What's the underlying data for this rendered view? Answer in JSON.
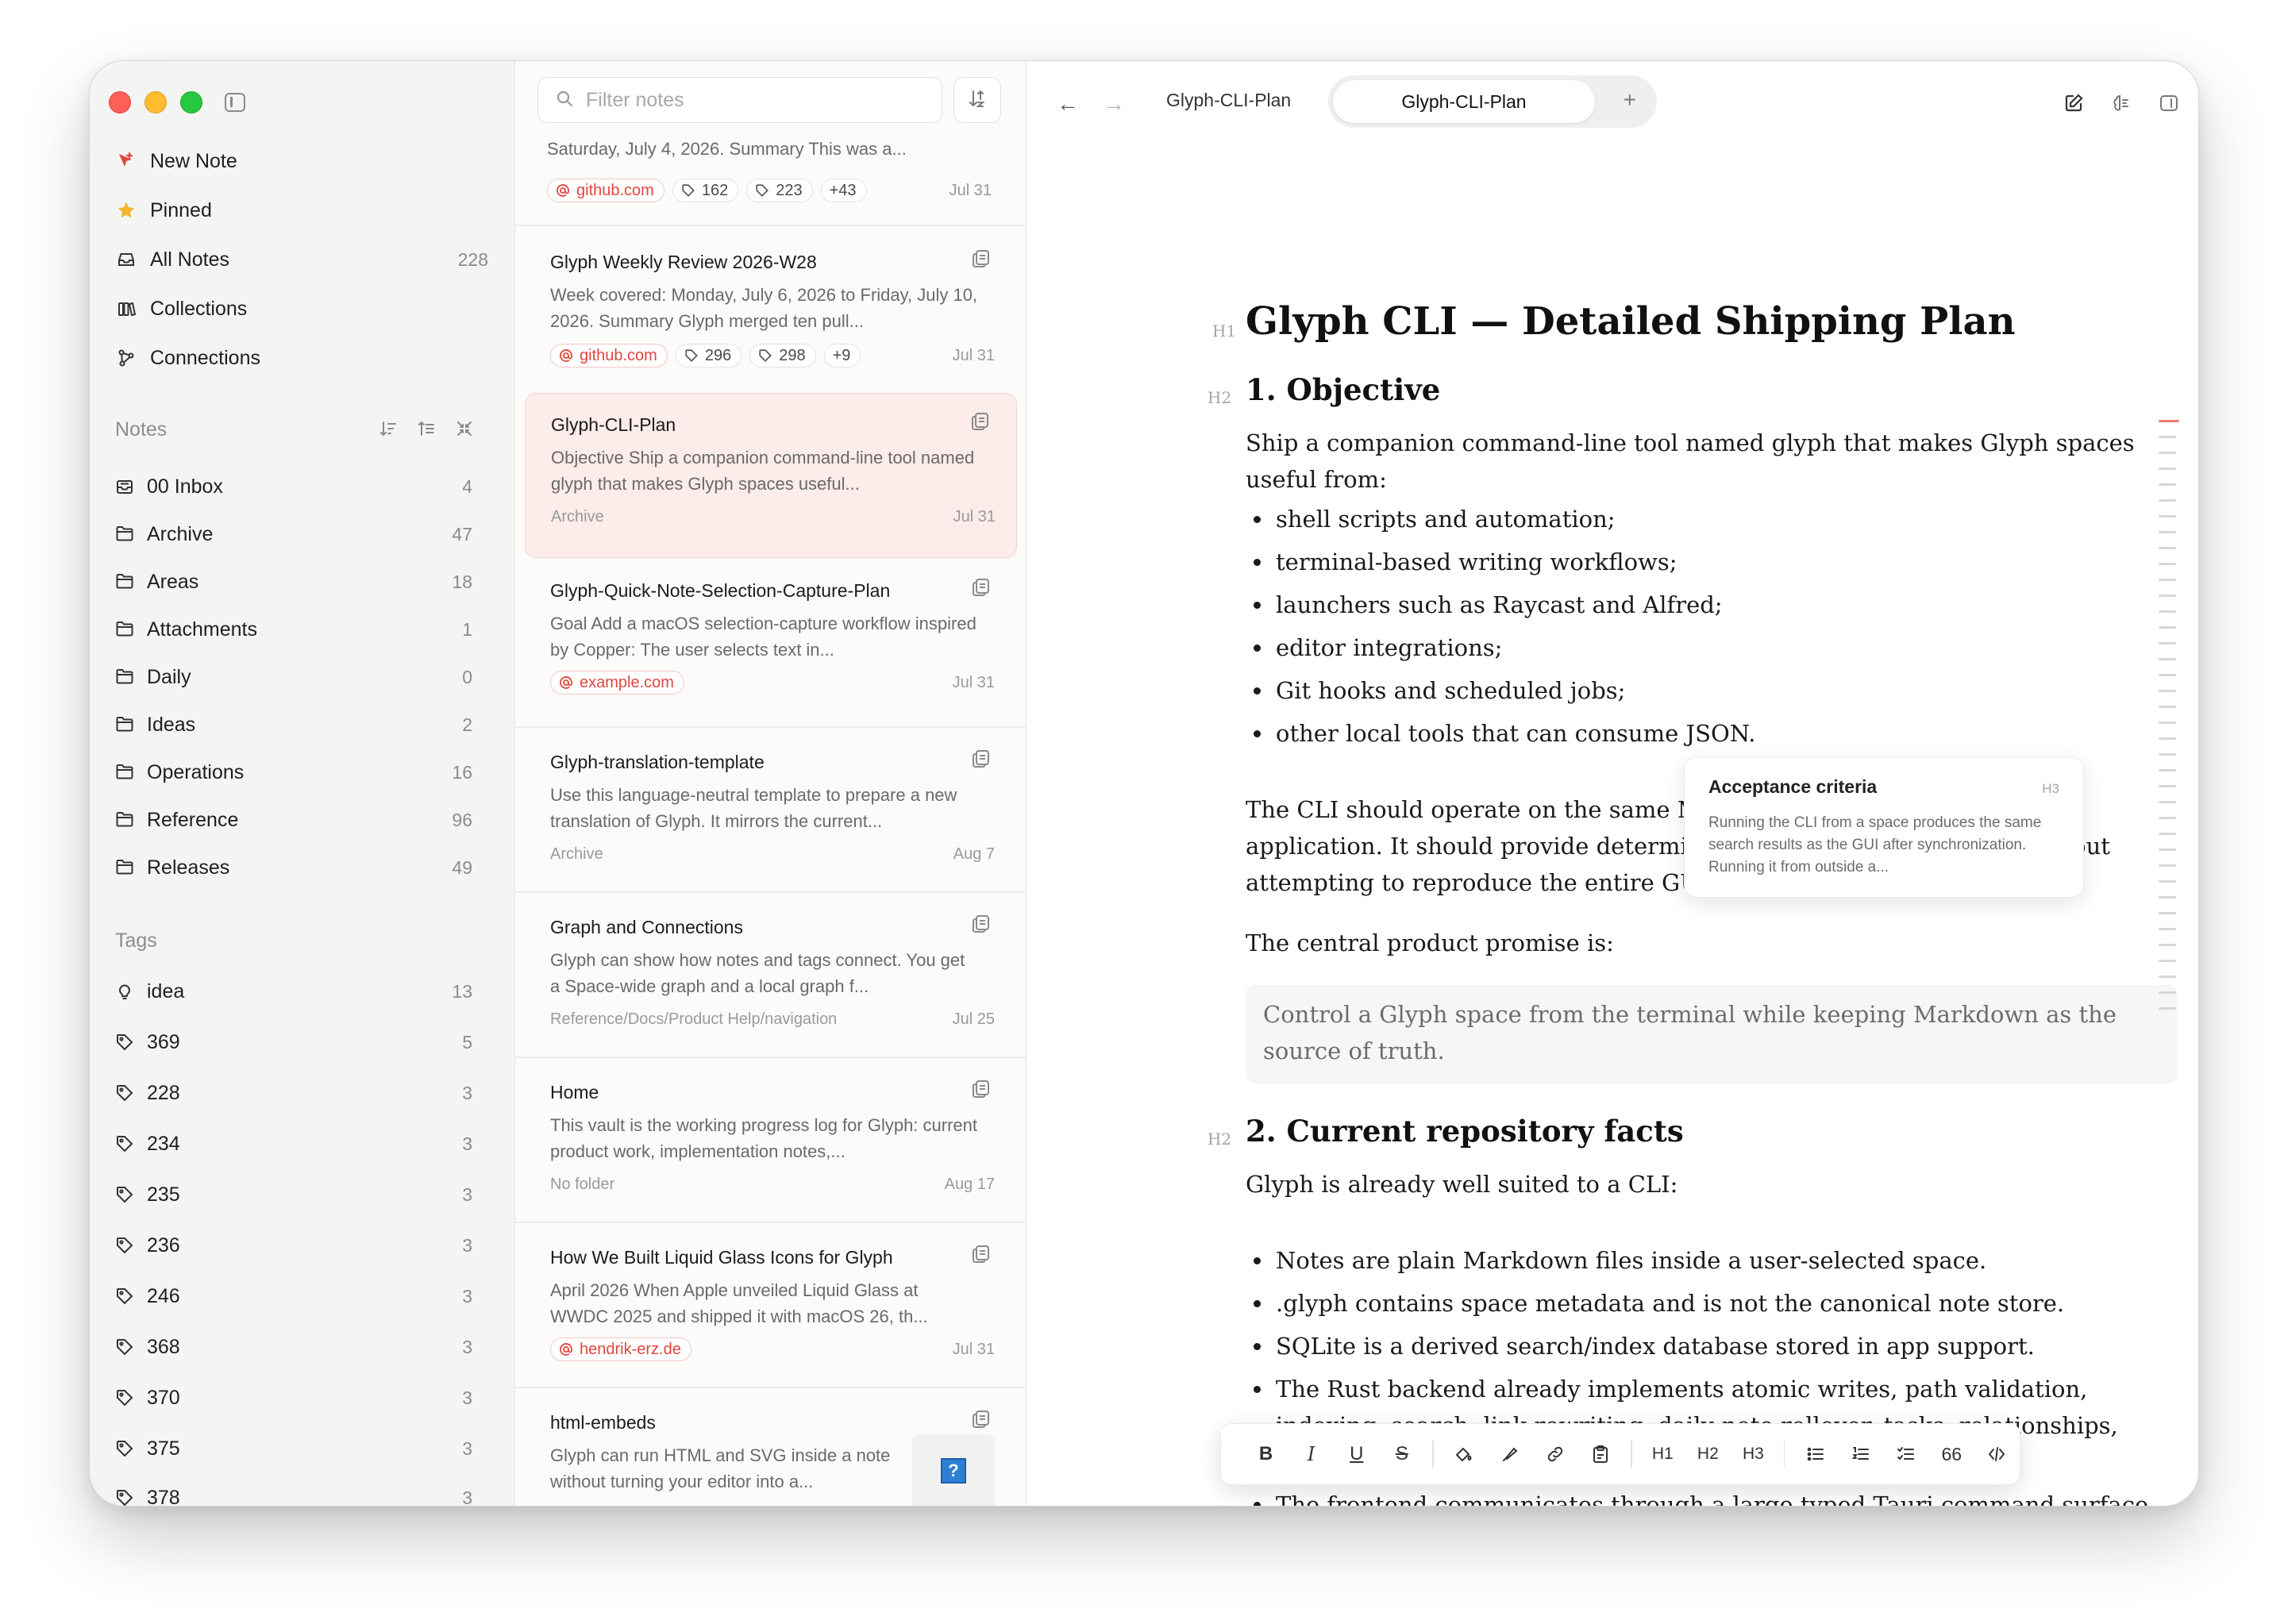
{
  "sidebar": {
    "nav": [
      {
        "label": "New Note",
        "icon": "new-note-icon",
        "count": ""
      },
      {
        "label": "Pinned",
        "icon": "star-icon",
        "count": ""
      },
      {
        "label": "All Notes",
        "icon": "tray-icon",
        "count": "228"
      },
      {
        "label": "Collections",
        "icon": "collections-icon",
        "count": ""
      },
      {
        "label": "Connections",
        "icon": "connections-icon",
        "count": ""
      }
    ],
    "notes_section_title": "Notes",
    "folders": [
      {
        "label": "00 Inbox",
        "count": "4",
        "icon": "inbox-icon"
      },
      {
        "label": "Archive",
        "count": "47",
        "icon": "folder-icon"
      },
      {
        "label": "Areas",
        "count": "18",
        "icon": "folder-icon"
      },
      {
        "label": "Attachments",
        "count": "1",
        "icon": "folder-icon"
      },
      {
        "label": "Daily",
        "count": "0",
        "icon": "folder-icon"
      },
      {
        "label": "Ideas",
        "count": "2",
        "icon": "folder-icon"
      },
      {
        "label": "Operations",
        "count": "16",
        "icon": "folder-icon"
      },
      {
        "label": "Reference",
        "count": "96",
        "icon": "folder-icon"
      },
      {
        "label": "Releases",
        "count": "49",
        "icon": "folder-icon"
      }
    ],
    "tags_section_title": "Tags",
    "tags": [
      {
        "label": "idea",
        "count": "13",
        "icon": "lightbulb-icon"
      },
      {
        "label": "369",
        "count": "5",
        "icon": "tag-icon"
      },
      {
        "label": "228",
        "count": "3",
        "icon": "tag-icon"
      },
      {
        "label": "234",
        "count": "3",
        "icon": "tag-icon"
      },
      {
        "label": "235",
        "count": "3",
        "icon": "tag-icon"
      },
      {
        "label": "236",
        "count": "3",
        "icon": "tag-icon"
      },
      {
        "label": "246",
        "count": "3",
        "icon": "tag-icon"
      },
      {
        "label": "368",
        "count": "3",
        "icon": "tag-icon"
      },
      {
        "label": "370",
        "count": "3",
        "icon": "tag-icon"
      },
      {
        "label": "375",
        "count": "3",
        "icon": "tag-icon"
      },
      {
        "label": "378",
        "count": "3",
        "icon": "tag-icon"
      }
    ]
  },
  "notes_list": {
    "filter_placeholder": "Filter notes",
    "partial_top": {
      "snippet": "Saturday, July 4, 2026. Summary This was a...",
      "chips": [
        "github.com",
        "162",
        "223",
        "+43"
      ],
      "date": "Jul 31"
    },
    "notes": [
      {
        "title": "Glyph Weekly Review 2026-W28",
        "snippet": "Week covered: Monday, July 6, 2026 to Friday, July 10, 2026. Summary Glyph merged ten pull...",
        "chips": [
          "github.com",
          "296",
          "298",
          "+9"
        ],
        "folder": "",
        "date": "Jul 31",
        "selected": false
      },
      {
        "title": "Glyph-CLI-Plan",
        "snippet": "Objective Ship a companion command-line tool named glyph that makes Glyph spaces useful...",
        "chips": [],
        "folder": "Archive",
        "date": "Jul 31",
        "selected": true
      },
      {
        "title": "Glyph-Quick-Note-Selection-Capture-Plan",
        "snippet": "Goal Add a macOS selection-capture workflow inspired by Copper: The user selects text in...",
        "chips": [
          "example.com"
        ],
        "folder": "",
        "date": "Jul 31",
        "selected": false
      },
      {
        "title": "Glyph-translation-template",
        "snippet": "Use this language-neutral template to prepare a new translation of Glyph. It mirrors the current...",
        "chips": [],
        "folder": "Archive",
        "date": "Aug 7",
        "selected": false
      },
      {
        "title": "Graph and Connections",
        "snippet": "Glyph can show how notes and tags connect. You get a Space-wide graph and a local graph f...",
        "chips": [],
        "folder": "Reference/Docs/Product Help/navigation",
        "date": "Jul 25",
        "selected": false
      },
      {
        "title": "Home",
        "snippet": "This vault is the working progress log for Glyph: current product work, implementation notes,...",
        "chips": [],
        "folder": "No folder",
        "date": "Aug 17",
        "selected": false
      },
      {
        "title": "How We Built Liquid Glass Icons for Glyph",
        "snippet": "April 2026 When Apple unveiled Liquid Glass at WWDC 2025 and shipped it with macOS 26, th...",
        "chips": [
          "hendrik-erz.de"
        ],
        "folder": "",
        "date": "Jul 31",
        "selected": false
      },
      {
        "title": "html-embeds",
        "snippet": "Glyph can run HTML and SVG inside a note without turning your editor into a...",
        "chips": [],
        "folder": "",
        "date": "",
        "selected": false
      }
    ],
    "help_label": "?"
  },
  "editor": {
    "tabs": [
      {
        "label": "Glyph-CLI-Plan",
        "active": false
      },
      {
        "label": "Glyph-CLI-Plan",
        "active": true
      }
    ],
    "add_tab": "+",
    "back": "←",
    "forward": "→",
    "doc": {
      "h1_label": "H1",
      "h1": "Glyph CLI — Detailed Shipping Plan",
      "s1_label": "H2",
      "s1_title": "1. Objective",
      "s1_intro": "Ship a companion command-line tool named glyph that makes Glyph spaces useful from:",
      "s1_bullets": [
        "shell scripts and automation;",
        "terminal-based writing workflows;",
        "launchers such as Raycast and Alfred;",
        "editor integrations;",
        "Git hooks and scheduled jobs;",
        "other local tools that can consume JSON."
      ],
      "s1_para2": "The CLI should operate on the same Markdown files as the desktop application. It should provide deterministic, scriptable operations without attempting to reproduce the entire GUI.",
      "s1_para3": "The central product promise is:",
      "quote": "Control a Glyph space from the terminal while keeping Markdown as the source of truth.",
      "s2_label": "H2",
      "s2_title": "2. Current repository facts",
      "s2_intro": "Glyph is already well suited to a CLI:",
      "s2_bullets": [
        "Notes are plain Markdown files inside a user-selected space.",
        ".glyph contains space metadata and is not the canonical note store.",
        "SQLite is a derived search/index database stored in app support.",
        "The Rust backend already implements atomic writes, path validation, indexing, search, link rewriting, daily-note rollover, tasks, relationships, collections, and Git integration.",
        "The frontend communicates through a large typed Tauri command surface in"
      ]
    },
    "popover": {
      "title": "Acceptance criteria",
      "level": "H3",
      "desc": "Running the CLI from a space produces the same search results as the GUI after synchronization. Running it from outside a..."
    },
    "format_bar": [
      "B",
      "I",
      "U",
      "S",
      "highlight",
      "marker",
      "link",
      "paste",
      "H1",
      "H2",
      "H3",
      "bullet-list",
      "numbered-list",
      "task-list",
      "66",
      "code"
    ]
  },
  "colors": {
    "accent": "#e0463d",
    "selected_note_bg": "#fcecea",
    "sidebar_bg": "#f4f4f3"
  }
}
